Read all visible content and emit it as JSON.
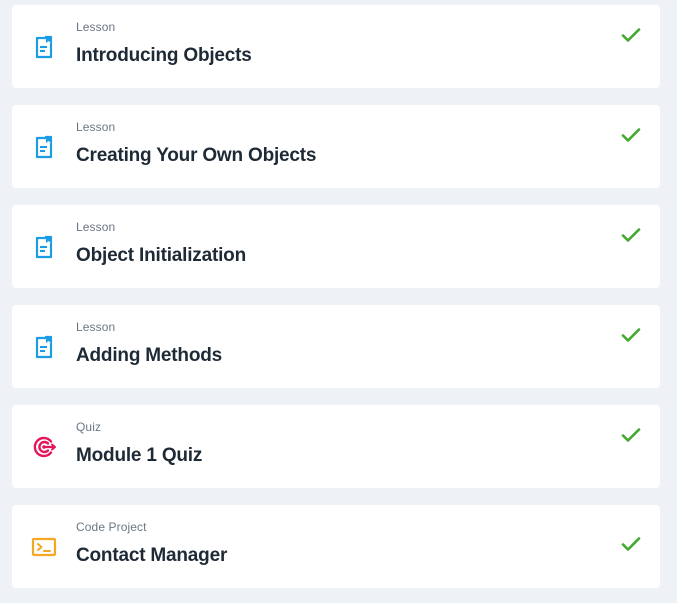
{
  "colors": {
    "lesson_icon": "#1b9ce4",
    "quiz_icon": "#e3165b",
    "code_icon": "#f5a623",
    "check": "#43a92f",
    "background": "#eef1f5",
    "card": "#ffffff",
    "title_text": "#1f2a37",
    "type_text": "#6b7785"
  },
  "items": [
    {
      "type": "Lesson",
      "title": "Introducing Objects",
      "icon": "lesson-document-icon",
      "completed": true
    },
    {
      "type": "Lesson",
      "title": "Creating Your Own Objects",
      "icon": "lesson-document-icon",
      "completed": true
    },
    {
      "type": "Lesson",
      "title": "Object Initialization",
      "icon": "lesson-document-icon",
      "completed": true
    },
    {
      "type": "Lesson",
      "title": "Adding Methods",
      "icon": "lesson-document-icon",
      "completed": true
    },
    {
      "type": "Quiz",
      "title": "Module 1 Quiz",
      "icon": "quiz-target-icon",
      "completed": true
    },
    {
      "type": "Code Project",
      "title": "Contact Manager",
      "icon": "code-terminal-icon",
      "completed": true
    }
  ]
}
